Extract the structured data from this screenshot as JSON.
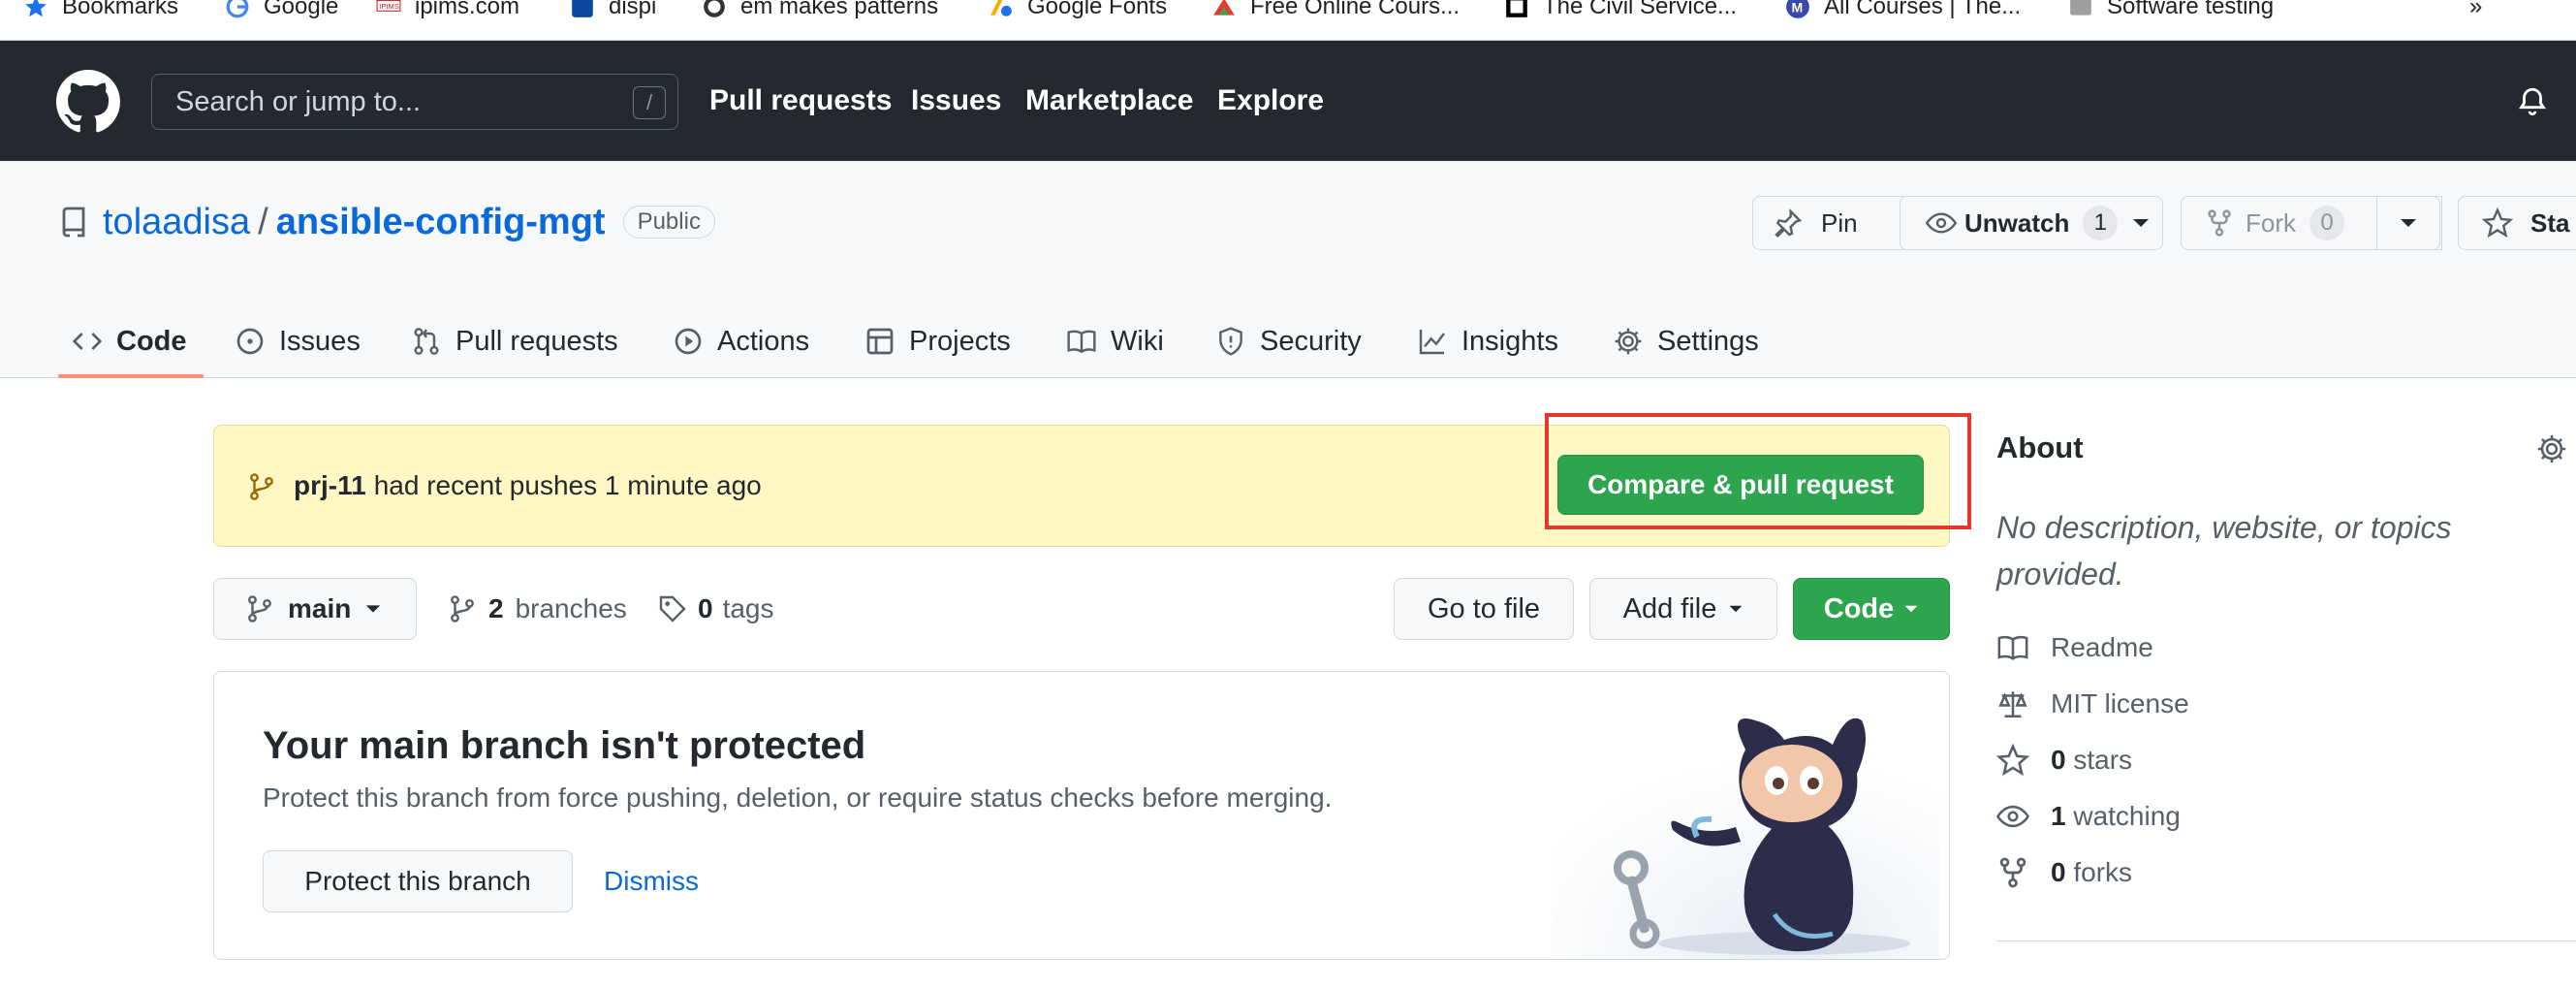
{
  "bookmarks": [
    {
      "icon": "star-icon",
      "label": "Bookmarks"
    },
    {
      "icon": "google-icon",
      "label": "Google"
    },
    {
      "icon": "ipims-icon",
      "label": "ipims.com"
    },
    {
      "icon": "spe-icon",
      "label": "dispi"
    },
    {
      "icon": "globe-icon",
      "label": "em makes patterns"
    },
    {
      "icon": "google-fonts-icon",
      "label": "Google Fonts"
    },
    {
      "icon": "courses-icon",
      "label": "Free Online Cours..."
    },
    {
      "icon": "civil-service-icon",
      "label": "The Civil Service..."
    },
    {
      "icon": "m-icon",
      "label": "All Courses | The..."
    },
    {
      "icon": "folder-icon",
      "label": "Software testing"
    }
  ],
  "bookmarks_more": "»",
  "header": {
    "search_placeholder": "Search or jump to...",
    "search_shortcut": "/",
    "nav": [
      "Pull requests",
      "Issues",
      "Marketplace",
      "Explore"
    ]
  },
  "repo": {
    "owner": "tolaadisa",
    "separator": "/",
    "name": "ansible-config-mgt",
    "visibility": "Public",
    "pin_label": "Pin",
    "unwatch_label": "Unwatch",
    "unwatch_count": "1",
    "fork_label": "Fork",
    "fork_count": "0",
    "star_label": "Sta"
  },
  "tabs": [
    "Code",
    "Issues",
    "Pull requests",
    "Actions",
    "Projects",
    "Wiki",
    "Security",
    "Insights",
    "Settings"
  ],
  "flash": {
    "branch": "prj-11",
    "message": "had recent pushes 1 minute ago",
    "button": "Compare & pull request"
  },
  "toolbar": {
    "branch": "main",
    "branches_count": "2",
    "branches_label": "branches",
    "tags_count": "0",
    "tags_label": "tags",
    "go_to_file": "Go to file",
    "add_file": "Add file",
    "code": "Code"
  },
  "protect": {
    "title": "Your main branch isn't protected",
    "description": "Protect this branch from force pushing, deletion, or require status checks before merging.",
    "protect_button": "Protect this branch",
    "dismiss": "Dismiss"
  },
  "about": {
    "title": "About",
    "description": "No description, website, or topics provided.",
    "readme": "Readme",
    "license": "MIT license",
    "stars_count": "0",
    "stars_label": "stars",
    "watching_count": "1",
    "watching_label": "watching",
    "forks_count": "0",
    "forks_label": "forks"
  },
  "colors": {
    "header_bg": "#24292f",
    "link_blue": "#0969da",
    "green_button": "#2da44e",
    "flash_bg": "#fff8c5",
    "highlight_red": "#e5382a",
    "tab_underline": "#fd8c73"
  }
}
